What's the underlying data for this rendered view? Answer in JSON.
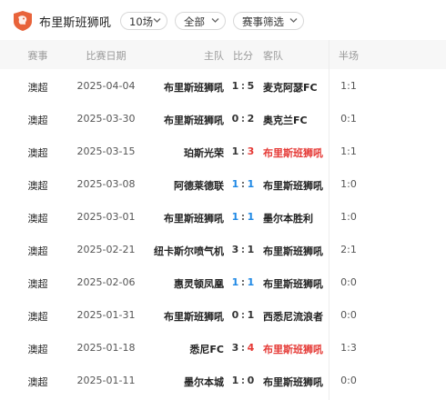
{
  "header": {
    "team_name": "布里斯班狮吼",
    "count_filter": "10场",
    "scope_filter": "全部",
    "event_filter": "赛事筛选"
  },
  "colors": {
    "win": "#e53935",
    "draw": "#1e88e5",
    "loss": "#333333",
    "logo": "#e8633a"
  },
  "columns": {
    "league": "赛事",
    "date": "比赛日期",
    "home": "主队",
    "score": "比分",
    "away": "客队",
    "half": "半场"
  },
  "matches": [
    {
      "league": "澳超",
      "date": "2025-04-04",
      "home": "布里斯班狮吼",
      "home_goals": "1",
      "away_goals": "5",
      "away": "麦克阿瑟FC",
      "half": "1:1",
      "result": "loss",
      "highlight": ""
    },
    {
      "league": "澳超",
      "date": "2025-03-30",
      "home": "布里斯班狮吼",
      "home_goals": "0",
      "away_goals": "2",
      "away": "奥克兰FC",
      "half": "0:1",
      "result": "loss",
      "highlight": ""
    },
    {
      "league": "澳超",
      "date": "2025-03-15",
      "home": "珀斯光荣",
      "home_goals": "1",
      "away_goals": "3",
      "away": "布里斯班狮吼",
      "half": "1:1",
      "result": "win",
      "highlight": "away"
    },
    {
      "league": "澳超",
      "date": "2025-03-08",
      "home": "阿德莱德联",
      "home_goals": "1",
      "away_goals": "1",
      "away": "布里斯班狮吼",
      "half": "1:0",
      "result": "draw",
      "highlight": ""
    },
    {
      "league": "澳超",
      "date": "2025-03-01",
      "home": "布里斯班狮吼",
      "home_goals": "1",
      "away_goals": "1",
      "away": "墨尔本胜利",
      "half": "1:0",
      "result": "draw",
      "highlight": ""
    },
    {
      "league": "澳超",
      "date": "2025-02-21",
      "home": "纽卡斯尔喷气机",
      "home_goals": "3",
      "away_goals": "1",
      "away": "布里斯班狮吼",
      "half": "2:1",
      "result": "loss",
      "highlight": ""
    },
    {
      "league": "澳超",
      "date": "2025-02-06",
      "home": "惠灵顿凤凰",
      "home_goals": "1",
      "away_goals": "1",
      "away": "布里斯班狮吼",
      "half": "0:0",
      "result": "draw",
      "highlight": ""
    },
    {
      "league": "澳超",
      "date": "2025-01-31",
      "home": "布里斯班狮吼",
      "home_goals": "0",
      "away_goals": "1",
      "away": "西悉尼流浪者",
      "half": "0:0",
      "result": "loss",
      "highlight": ""
    },
    {
      "league": "澳超",
      "date": "2025-01-18",
      "home": "悉尼FC",
      "home_goals": "3",
      "away_goals": "4",
      "away": "布里斯班狮吼",
      "half": "1:3",
      "result": "win",
      "highlight": "away"
    },
    {
      "league": "澳超",
      "date": "2025-01-11",
      "home": "墨尔本城",
      "home_goals": "1",
      "away_goals": "0",
      "away": "布里斯班狮吼",
      "half": "0:0",
      "result": "loss",
      "highlight": ""
    }
  ]
}
